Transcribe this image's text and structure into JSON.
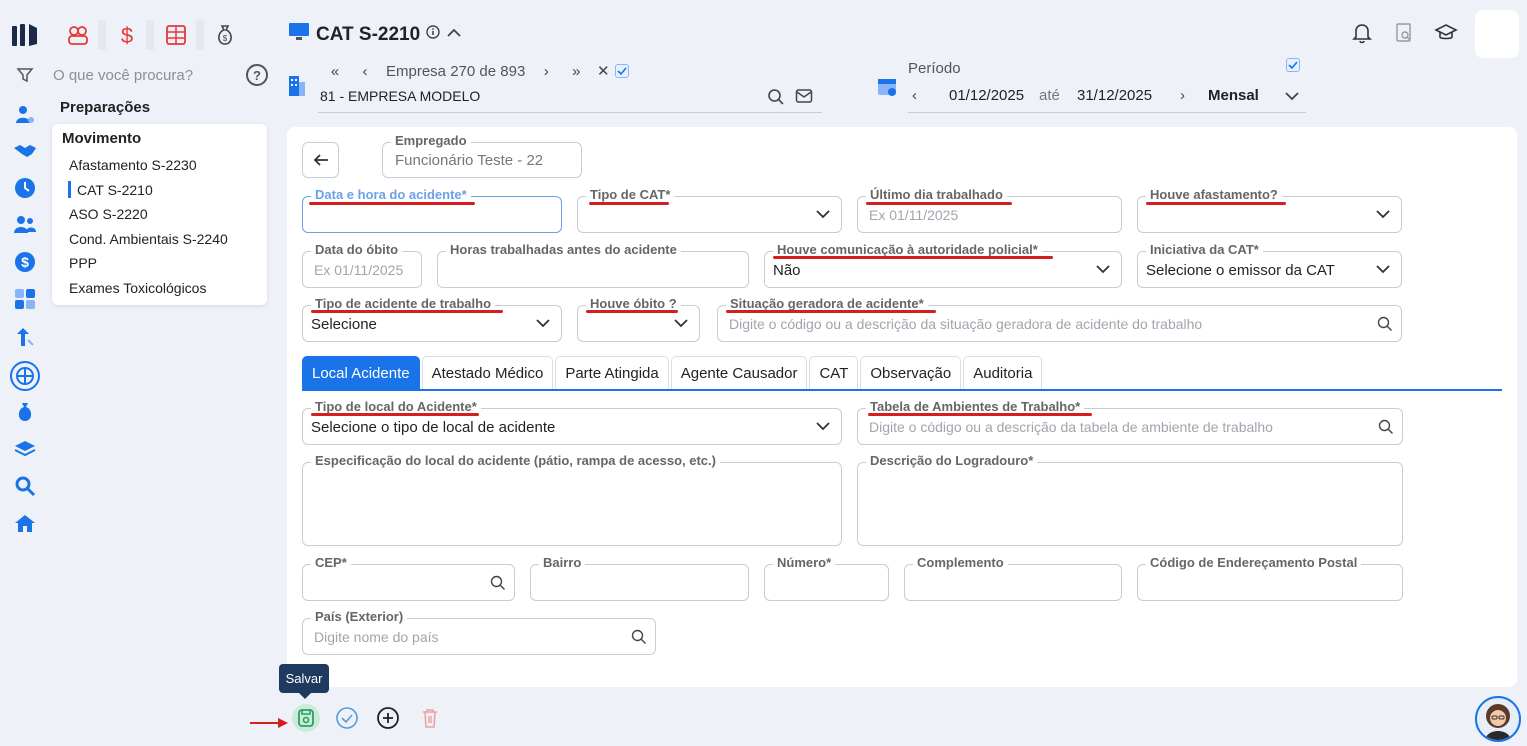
{
  "sidebar": {
    "search_placeholder": "O que você procura?",
    "help_label": "?",
    "section_title": "Preparações",
    "menu_title": "Movimento",
    "menu_items": [
      "Afastamento S-2230",
      "CAT S-2210",
      "ASO S-2220",
      "Cond. Ambientais S-2240",
      "PPP",
      "Exames Toxicológicos"
    ],
    "active_item": "CAT S-2210"
  },
  "header": {
    "title": "CAT S-2210",
    "empresa_prefix": "Empresa",
    "empresa_index": "270",
    "empresa_of": "de",
    "empresa_total": "893",
    "empresa_name": "81 - EMPRESA MODELO",
    "periodo_label": "Período",
    "periodo_start": "01/12/2025",
    "periodo_sep": "até",
    "periodo_end": "31/12/2025",
    "periodo_tipo": "Mensal"
  },
  "form": {
    "empregado_label": "Empregado",
    "empregado_value": "Funcionário Teste - 22",
    "data_hora_label": "Data e hora do acidente*",
    "tipo_cat_label": "Tipo de CAT*",
    "ultimo_dia_label": "Último dia trabalhado",
    "ultimo_dia_placeholder": "Ex 01/11/2025",
    "afastamento_label": "Houve afastamento?",
    "data_obito_label": "Data do óbito",
    "data_obito_placeholder": "Ex 01/11/2025",
    "horas_label": "Horas trabalhadas antes do acidente",
    "comunicacao_label": "Houve comunicação à autoridade policial*",
    "comunicacao_value": "Não",
    "iniciativa_label": "Iniciativa da CAT*",
    "iniciativa_value": "Selecione o emissor da CAT",
    "tipo_acidente_label": "Tipo de acidente de trabalho",
    "tipo_acidente_value": "Selecione",
    "obito_label": "Houve óbito ?",
    "situacao_label": "Situação geradora de acidente*",
    "situacao_placeholder": "Digite o código ou a descrição da situação geradora de acidente do trabalho"
  },
  "tabs": [
    "Local Acidente",
    "Atestado Médico",
    "Parte Atingida",
    "Agente Causador",
    "CAT",
    "Observação",
    "Auditoria"
  ],
  "local": {
    "tipo_local_label": "Tipo de local do Acidente*",
    "tipo_local_value": "Selecione o tipo de local de acidente",
    "tabela_label": "Tabela de Ambientes de Trabalho*",
    "tabela_placeholder": "Digite o código ou a descrição da tabela de ambiente de trabalho",
    "especificacao_label": "Especificação do local do acidente (pátio, rampa de acesso, etc.)",
    "logradouro_label": "Descrição do Logradouro*",
    "cep_label": "CEP*",
    "bairro_label": "Bairro",
    "numero_label": "Número*",
    "complemento_label": "Complemento",
    "codigo_postal_label": "Código de Endereçamento Postal",
    "pais_label": "País (Exterior)",
    "pais_placeholder": "Digite nome do país"
  },
  "toolbar": {
    "save_tooltip": "Salvar"
  },
  "colors": {
    "accent": "#1a73e8",
    "underline": "#d41f1f",
    "save": "#2e9e6a"
  }
}
